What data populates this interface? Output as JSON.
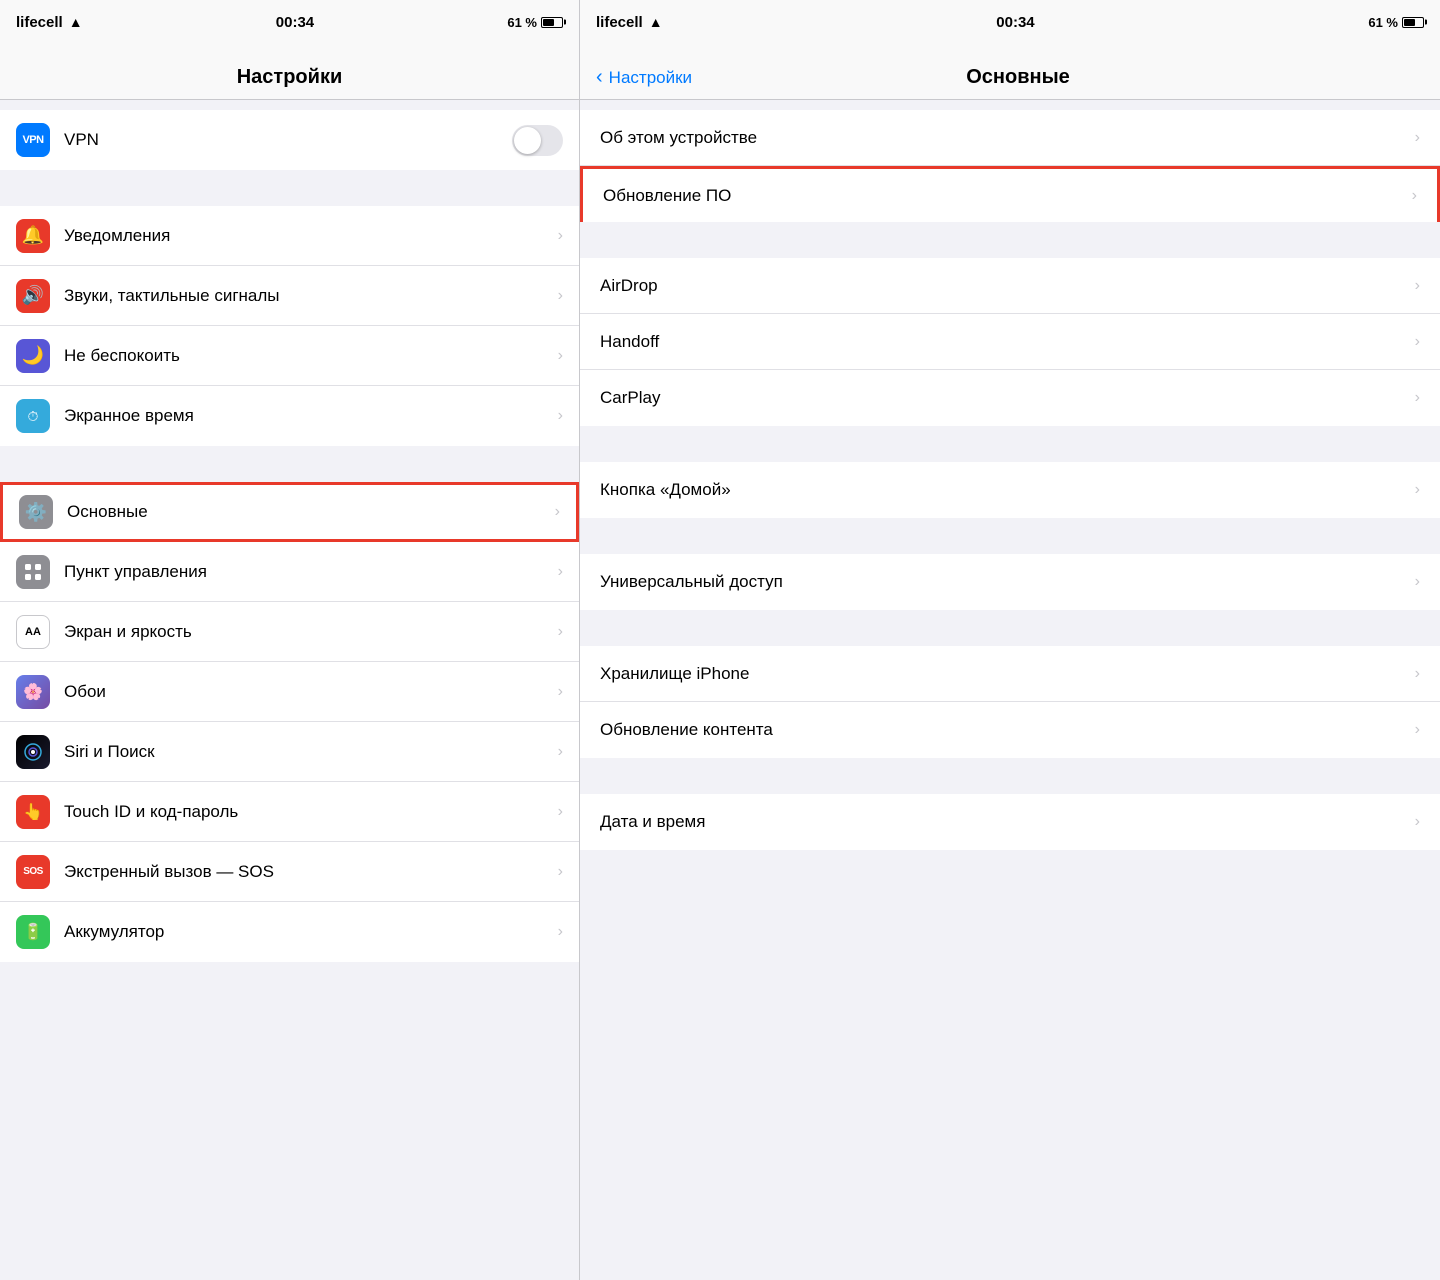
{
  "left": {
    "status": {
      "carrier": "lifecell",
      "time": "00:34",
      "battery_pct": "61 %"
    },
    "nav_title": "Настройки",
    "top_section": [
      {
        "id": "vpn",
        "icon": "VPN",
        "icon_bg": "bg-blue",
        "label": "VPN",
        "has_toggle": true,
        "has_chevron": false
      }
    ],
    "sections": [
      {
        "items": [
          {
            "id": "notifications",
            "icon": "🔔",
            "icon_bg": "bg-red",
            "label": "Уведомления",
            "has_chevron": true
          },
          {
            "id": "sounds",
            "icon": "🔊",
            "icon_bg": "bg-pink-red",
            "label": "Звуки, тактильные сигналы",
            "has_chevron": true
          },
          {
            "id": "dnd",
            "icon": "🌙",
            "icon_bg": "bg-purple",
            "label": "Не беспокоить",
            "has_chevron": true
          },
          {
            "id": "screen-time",
            "icon": "⏱",
            "icon_bg": "bg-indigo",
            "label": "Экранное время",
            "has_chevron": true
          }
        ]
      },
      {
        "items": [
          {
            "id": "general",
            "icon": "⚙️",
            "icon_bg": "bg-gray",
            "label": "Основные",
            "has_chevron": true,
            "highlighted": true
          },
          {
            "id": "control-center",
            "icon": "⊞",
            "icon_bg": "bg-gray",
            "label": "Пункт управления",
            "has_chevron": true
          },
          {
            "id": "display",
            "icon": "AA",
            "icon_bg": "bg-aa",
            "label": "Экран и яркость",
            "has_chevron": true
          },
          {
            "id": "wallpaper",
            "icon": "🌸",
            "icon_bg": "bg-wallpaper",
            "label": "Обои",
            "has_chevron": true
          },
          {
            "id": "siri",
            "icon": "◎",
            "icon_bg": "bg-siri",
            "label": "Siri и Поиск",
            "has_chevron": true
          },
          {
            "id": "touch-id",
            "icon": "👆",
            "icon_bg": "bg-touch",
            "label": "Touch ID и код-пароль",
            "has_chevron": true
          },
          {
            "id": "sos",
            "icon": "SOS",
            "icon_bg": "bg-sos",
            "label": "Экстренный вызов — SOS",
            "has_chevron": true
          },
          {
            "id": "battery",
            "icon": "🔋",
            "icon_bg": "bg-battery",
            "label": "Аккумулятор",
            "has_chevron": true
          }
        ]
      }
    ]
  },
  "right": {
    "status": {
      "carrier": "lifecell",
      "time": "00:34",
      "battery_pct": "61 %"
    },
    "nav_back": "Настройки",
    "nav_title": "Основные",
    "sections": [
      {
        "items": [
          {
            "id": "about",
            "label": "Об этом устройстве",
            "has_chevron": true
          },
          {
            "id": "software-update",
            "label": "Обновление ПО",
            "has_chevron": true,
            "highlighted": true
          }
        ]
      },
      {
        "items": [
          {
            "id": "airdrop",
            "label": "AirDrop",
            "has_chevron": true
          },
          {
            "id": "handoff",
            "label": "Handoff",
            "has_chevron": true
          },
          {
            "id": "carplay",
            "label": "CarPlay",
            "has_chevron": true
          }
        ]
      },
      {
        "items": [
          {
            "id": "home-button",
            "label": "Кнопка «Домой»",
            "has_chevron": true
          }
        ]
      },
      {
        "items": [
          {
            "id": "accessibility",
            "label": "Универсальный доступ",
            "has_chevron": true
          }
        ]
      },
      {
        "items": [
          {
            "id": "iphone-storage",
            "label": "Хранилище iPhone",
            "has_chevron": true
          },
          {
            "id": "background-app",
            "label": "Обновление контента",
            "has_chevron": true
          }
        ]
      },
      {
        "items": [
          {
            "id": "date-time",
            "label": "Дата и время",
            "has_chevron": true
          }
        ]
      }
    ]
  }
}
